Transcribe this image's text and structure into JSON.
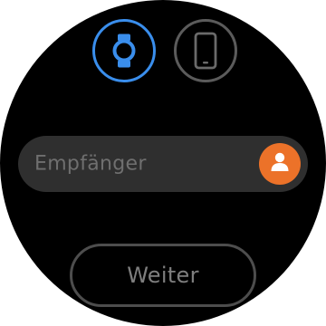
{
  "colors": {
    "accent": "#3a8eec",
    "contact_button": "#ec7229",
    "field_background": "#2f2f2f",
    "inactive_ring": "#5b5b5b"
  },
  "source_selector": {
    "options": [
      {
        "icon": "watch-icon",
        "selected": true
      },
      {
        "icon": "phone-icon",
        "selected": false
      }
    ]
  },
  "recipient": {
    "placeholder": "Empfänger",
    "contact_icon": "person-icon"
  },
  "actions": {
    "continue_label": "Weiter",
    "continue_enabled": false
  }
}
